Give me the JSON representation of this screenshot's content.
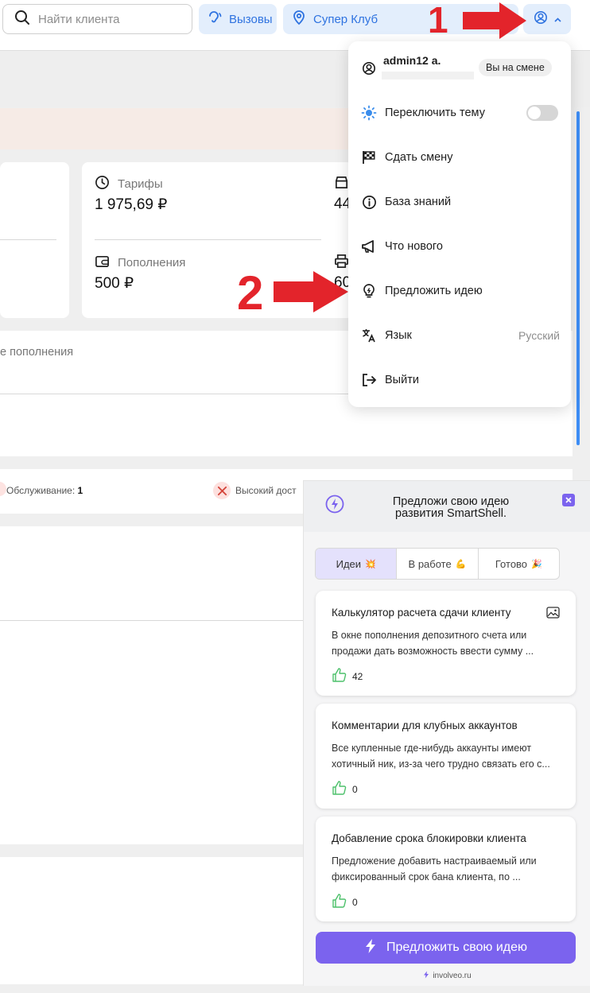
{
  "topbar": {
    "search_placeholder": "Найти клиента",
    "calls_label": "Вызовы",
    "club_label": "Супер Клуб"
  },
  "background": {
    "tariffs_label": "Тарифы",
    "tariffs_value": "1 975,69 ₽",
    "topups_label": "Пополнения",
    "topups_value": "500 ₽",
    "col3_value_top": "44",
    "col3_value_bottom": "60",
    "panel_a_text": "е пополнения",
    "service_label": "Обслуживание:",
    "service_count": "1",
    "high_label": "Высокий дост"
  },
  "annotations": {
    "first": "1",
    "second": "2"
  },
  "menu": {
    "username": "admin12 a.",
    "on_shift_badge": "Вы на смене",
    "items": [
      {
        "label": "Переключить тему",
        "icon": "sun-icon"
      },
      {
        "label": "Сдать смену",
        "icon": "checkered-flag-icon"
      },
      {
        "label": "База знаний",
        "icon": "info-icon"
      },
      {
        "label": "Что нового",
        "icon": "megaphone-icon"
      },
      {
        "label": "Предложить идею",
        "icon": "lightbulb-icon"
      },
      {
        "label": "Язык",
        "icon": "translate-icon",
        "value": "Русский"
      },
      {
        "label": "Выйти",
        "icon": "logout-icon"
      }
    ],
    "theme_toggle_on": false
  },
  "widget": {
    "header_line1": "Предложи свою идею",
    "header_line2": "развития SmartShell.",
    "tabs": [
      {
        "label": "Идеи",
        "emoji": "💥",
        "active": true
      },
      {
        "label": "В работе",
        "emoji": "💪",
        "active": false
      },
      {
        "label": "Готово",
        "emoji": "🎉",
        "active": false
      }
    ],
    "ideas": [
      {
        "title": "Калькулятор расчета сдачи клиенту",
        "desc": "В окне пополнения депозитного счета или продажи дать возможность ввести сумму ...",
        "likes": "42",
        "has_image": true
      },
      {
        "title": "Комментарии для клубных аккаунтов",
        "desc": "Все купленные где-нибудь аккаунты имеют хотичный ник, из-за чего трудно связать его с...",
        "likes": "0",
        "has_image": false
      },
      {
        "title": "Добавление срока блокировки клиента",
        "desc": "Предложение добавить настраиваемый или фиксированный срок бана клиента, по ...",
        "likes": "0",
        "has_image": false
      }
    ],
    "cta_label": "Предложить свою идею",
    "powered_by": "involveo.ru",
    "accent_color": "#7b63ee"
  }
}
